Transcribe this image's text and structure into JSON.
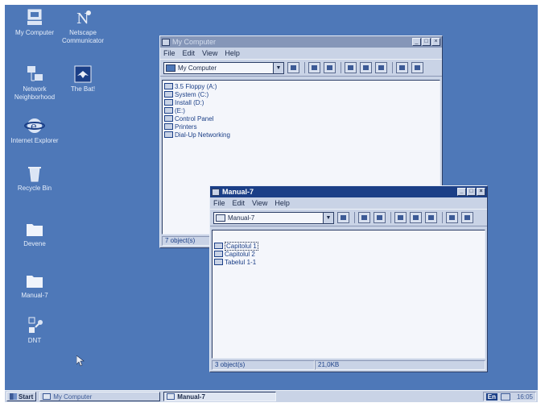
{
  "desktop": {
    "icons": [
      {
        "label": "My Computer",
        "icon": "monitor-icon"
      },
      {
        "label": "Netscape Communicator",
        "icon": "netscape-icon"
      },
      {
        "label": "Network Neighborhood",
        "icon": "network-icon"
      },
      {
        "label": "The Bat!",
        "icon": "bat-icon"
      },
      {
        "label": "Internet Explorer",
        "icon": "ie-icon"
      },
      {
        "label": "Recycle Bin",
        "icon": "recycle-bin-icon"
      },
      {
        "label": "Devene",
        "icon": "folder-icon"
      },
      {
        "label": "Manual-7",
        "icon": "folder-icon"
      },
      {
        "label": "DNT",
        "icon": "shortcut-icon"
      }
    ]
  },
  "my_computer_window": {
    "title": "My Computer",
    "menu": [
      "File",
      "Edit",
      "View",
      "Help"
    ],
    "address": "My Computer",
    "items": [
      "3.5 Floppy (A:)",
      "System (C:)",
      "Install (D:)",
      "(E:)",
      "Control Panel",
      "Printers",
      "Dial-Up Networking"
    ],
    "status": "7 object(s)"
  },
  "manual_window": {
    "title": "Manual-7",
    "menu": [
      "File",
      "Edit",
      "View",
      "Help"
    ],
    "address": "Manual-7",
    "items": [
      "Capitolul 1",
      "Capitolul 2",
      "Tabelul 1-1"
    ],
    "status_count": "3 object(s)",
    "status_size": "21,0KB"
  },
  "taskbar": {
    "start": "Start",
    "tasks": [
      "My Computer",
      "Manual-7"
    ],
    "lang": "En",
    "clock": "16:05"
  }
}
